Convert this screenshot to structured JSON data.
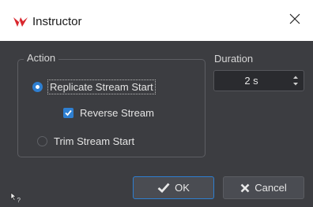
{
  "window": {
    "title": "Instructor",
    "close_icon": "close-icon",
    "app_icon": "instructor-logo-icon"
  },
  "action_group": {
    "title": "Action",
    "options": [
      {
        "label": "Replicate Stream Start",
        "selected": true
      },
      {
        "label": "Trim Stream Start",
        "selected": false
      }
    ],
    "reverse_stream": {
      "label": "Reverse Stream",
      "checked": true
    }
  },
  "duration": {
    "label": "Duration",
    "value": "2 s"
  },
  "buttons": {
    "ok_label": "OK",
    "cancel_label": "Cancel"
  },
  "colors": {
    "accent": "#2e7fd1",
    "dialog_bg": "#3c3d41",
    "titlebar_bg": "#ffffff"
  }
}
